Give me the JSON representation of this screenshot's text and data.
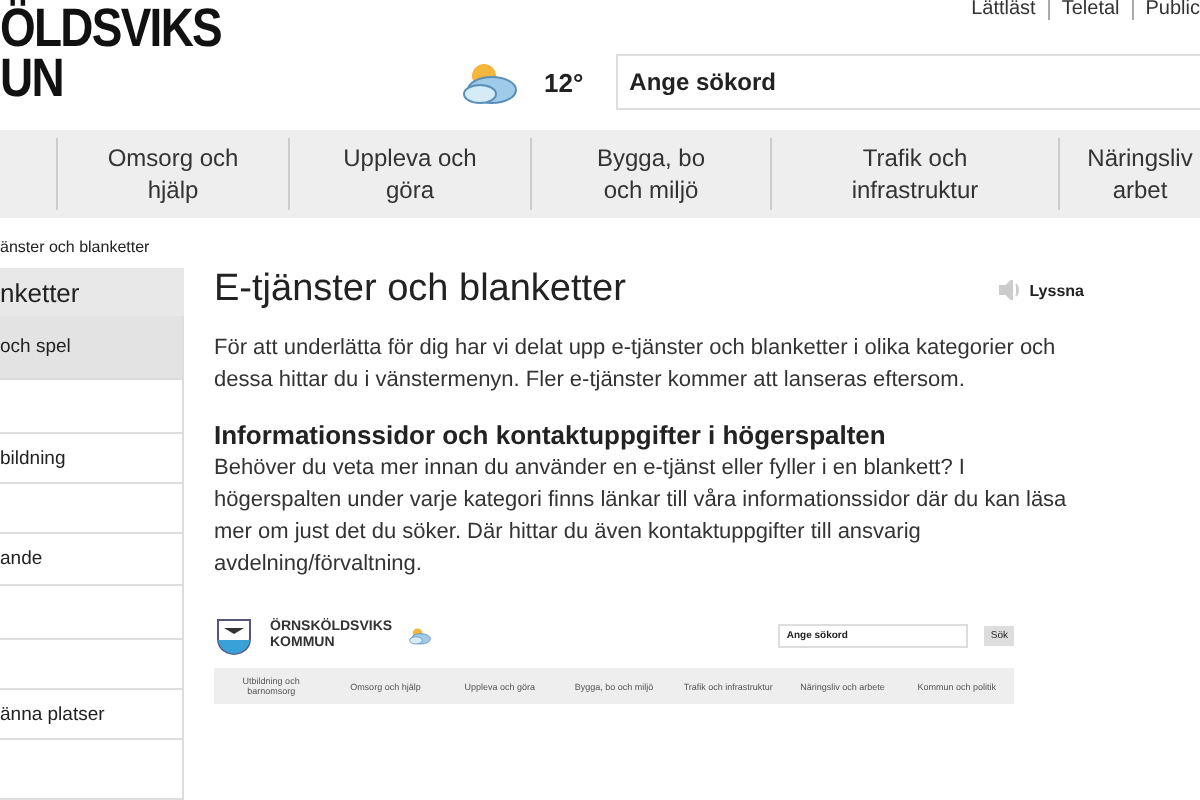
{
  "header": {
    "logo_lines": [
      "ÖLDSVIKS",
      "UN"
    ],
    "top_links": [
      "Lättläst",
      "Teletal",
      "Public"
    ],
    "weather": {
      "temperature": "12°"
    },
    "search": {
      "placeholder": "Ange sökord"
    }
  },
  "nav": [
    {
      "lines": [
        "Omsorg och",
        "hjälp"
      ]
    },
    {
      "lines": [
        "Uppleva och",
        "göra"
      ]
    },
    {
      "lines": [
        "Bygga, bo",
        "och miljö"
      ]
    },
    {
      "lines": [
        "Trafik och",
        "infrastruktur"
      ]
    },
    {
      "lines": [
        "Näringsliv",
        "arbet"
      ]
    }
  ],
  "breadcrumb": "änster och blanketter",
  "sidebar": {
    "title": "nketter",
    "items": [
      {
        "label": "och spel",
        "selected": true
      },
      {
        "selected": false
      },
      {
        "label": "bildning",
        "selected": false
      },
      {
        "selected": false
      },
      {
        "label": "ande",
        "selected": false
      },
      {
        "selected": false
      },
      {
        "selected": false
      },
      {
        "label": "änna platser",
        "selected": false
      },
      {
        "selected": false
      }
    ]
  },
  "content": {
    "title": "E-tjänster och blanketter",
    "listen": "Lyssna",
    "intro": "För att underlätta för dig har vi delat upp e-tjänster och blanketter i olika kategorier och dessa hittar du i vänstermenyn. Fler e-tjänster kommer att lanseras eftersom.",
    "heading": "Informationssidor och kontaktuppgifter i högerspalten",
    "body": "Behöver du veta mer innan du använder en e-tjänst eller fyller i en blankett? I högerspalten under varje kategori finns länkar till våra informationssidor där du kan läsa mer om just det du söker. Där hittar du även kontaktuppgifter till ansvarig avdelning/förvaltning.",
    "screenshot": {
      "logo_lines": [
        "ÖRNSKÖLDSVIKS",
        "KOMMUN"
      ],
      "search_placeholder": "Ange sökord",
      "search_button": "Sök",
      "nav": [
        "Utbildning och barnomsorg",
        "Omsorg och hjälp",
        "Uppleva och göra",
        "Bygga, bo och miljö",
        "Trafik och infrastruktur",
        "Näringsliv och arbete",
        "Kommun och politik"
      ]
    }
  }
}
